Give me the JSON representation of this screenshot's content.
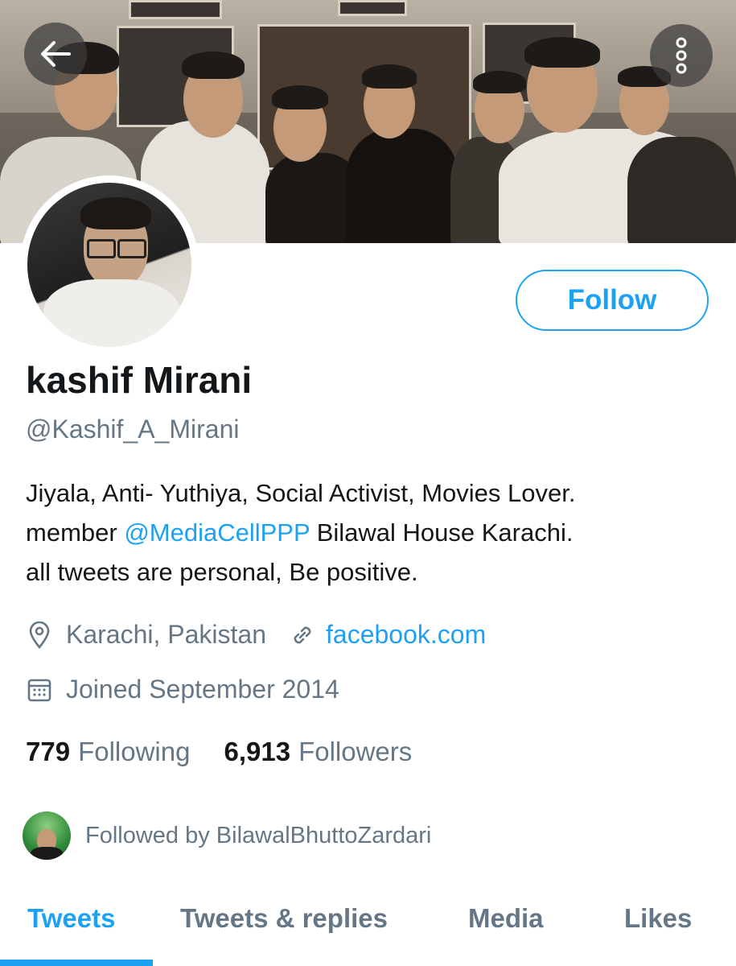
{
  "header": {
    "back_icon": "arrow-left-icon",
    "more_icon": "more-vertical-icon"
  },
  "profile": {
    "name": "kashif Mirani",
    "handle": "@Kashif_A_Mirani",
    "follow_label": "Follow",
    "bio_line1": "Jiyala, Anti- Yuthiya, Social Activist, Movies Lover.",
    "bio_line2_prefix": "member ",
    "bio_mention": "@MediaCellPPP",
    "bio_line2_suffix": " Bilawal House Karachi.",
    "bio_line3": "all tweets are personal, Be positive.",
    "location": "Karachi, Pakistan",
    "website": "facebook.com",
    "joined": "Joined September 2014",
    "following_count": "779",
    "following_label": "Following",
    "followers_count": "6,913",
    "followers_label": "Followers",
    "followed_by": "Followed by BilawalBhuttoZardari"
  },
  "tabs": [
    {
      "label": "Tweets",
      "active": true
    },
    {
      "label": "Tweets & replies",
      "active": false
    },
    {
      "label": "Media",
      "active": false
    },
    {
      "label": "Likes",
      "active": false
    }
  ],
  "colors": {
    "accent": "#1da1f2",
    "text": "#14171a",
    "secondary": "#657786"
  }
}
